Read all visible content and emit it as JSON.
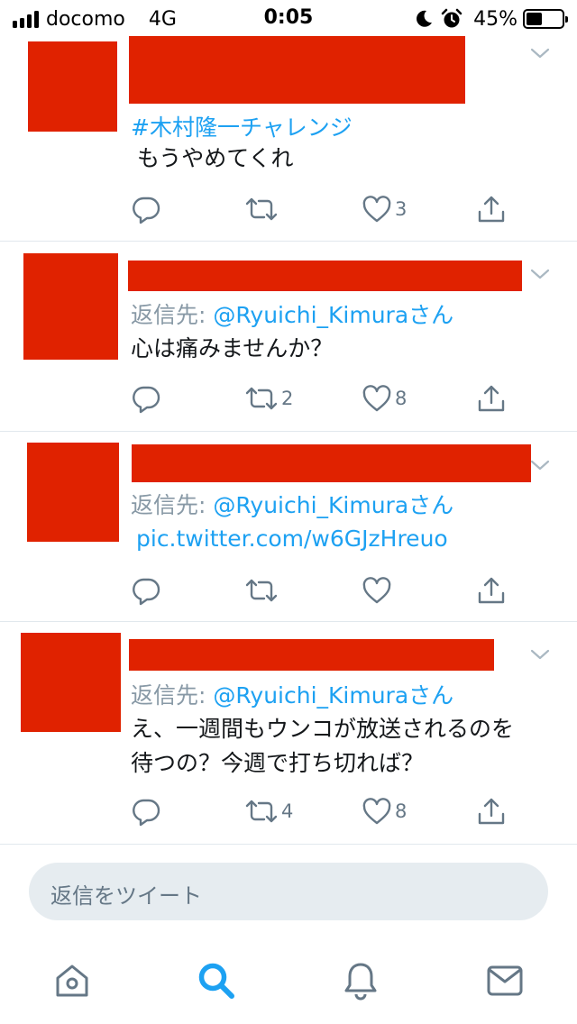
{
  "status_bar": {
    "carrier": "docomo",
    "network": "4G",
    "time": "0:05",
    "battery": "45%",
    "battery_level": 0.45,
    "icons": [
      "moon-icon",
      "alarm-icon"
    ]
  },
  "tweets": [
    {
      "hashtag": "#木村隆一チャレンジ",
      "text": "もうやめてくれ",
      "reply_count": "",
      "retweet_count": "",
      "like_count": "3"
    },
    {
      "reply_label": "返信先:",
      "reply_handle": "@Ryuichi_Kimuraさん",
      "text": "心は痛みませんか？",
      "reply_count": "",
      "retweet_count": "2",
      "like_count": "8"
    },
    {
      "reply_label": "返信先:",
      "reply_handle": "@Ryuichi_Kimuraさん",
      "link": "pic.twitter.com/w6GJzHreuo",
      "reply_count": "",
      "retweet_count": "",
      "like_count": ""
    },
    {
      "reply_label": "返信先:",
      "reply_handle": "@Ryuichi_Kimuraさん",
      "text_line1": "え、一週間もウンコが放送されるのを",
      "text_line2": "待つの？今週で打ち切れば？",
      "reply_count": "",
      "retweet_count": "4",
      "like_count": "8"
    }
  ],
  "reply_bar": {
    "placeholder": "返信をツイート"
  },
  "tab_bar": {
    "tabs": [
      "home-icon",
      "search-icon",
      "notifications-icon",
      "messages-icon"
    ],
    "active": "search-icon"
  },
  "colors": {
    "redaction": "#e02200",
    "link": "#1da1f2",
    "muted": "#657786",
    "icon": "#8899a6"
  }
}
